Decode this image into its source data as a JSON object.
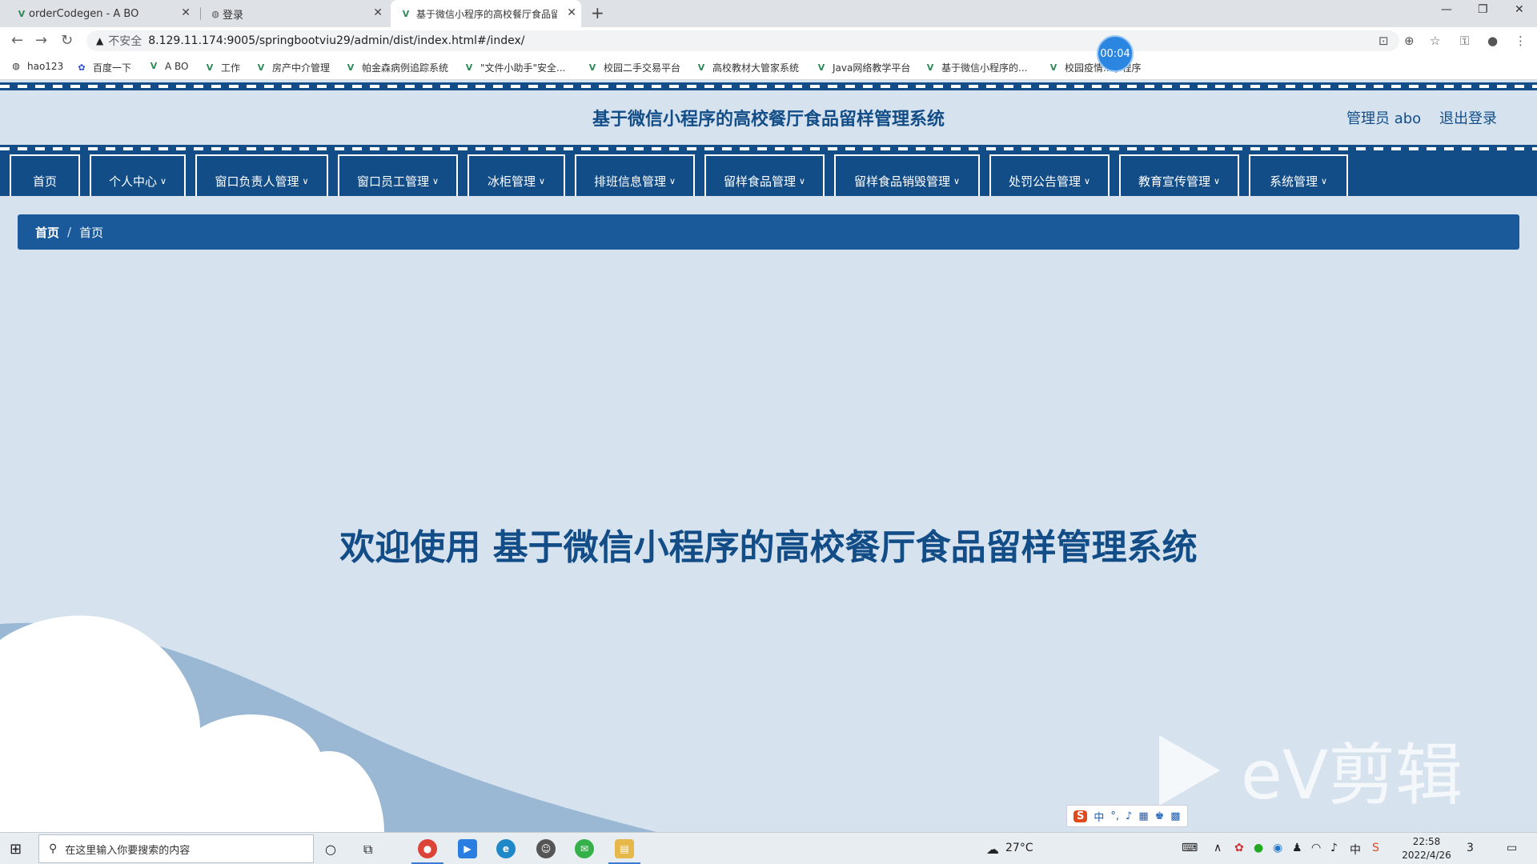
{
  "browser": {
    "tabs": [
      {
        "title": "orderCodegen - A BO"
      },
      {
        "title": "登录"
      },
      {
        "title": "基于微信小程序的高校餐厅食品留"
      }
    ],
    "address": {
      "insecure_label": "不安全",
      "url": "8.129.11.174:9005/springbootviu29/admin/dist/index.html#/index/"
    },
    "bookmarks": [
      "hao123",
      "百度一下",
      "A BO",
      "工作",
      "房产中介管理",
      "帕金森病例追踪系统",
      "\"文件小助手\"安全...",
      "校园二手交易平台",
      "高校教材大管家系统",
      "Java网络教学平台",
      "基于微信小程序的...",
      "校园疫情...小程序"
    ],
    "recording_timer": "00:04"
  },
  "app": {
    "title": "基于微信小程序的高校餐厅食品留样管理系统",
    "user": "管理员 abo",
    "logout": "退出登录",
    "nav": [
      {
        "label": "首页"
      },
      {
        "label": "个人中心"
      },
      {
        "label": "窗口负责人管理"
      },
      {
        "label": "窗口员工管理"
      },
      {
        "label": "冰柜管理"
      },
      {
        "label": "排班信息管理"
      },
      {
        "label": "留样食品管理"
      },
      {
        "label": "留样食品销毁管理"
      },
      {
        "label": "处罚公告管理"
      },
      {
        "label": "教育宣传管理"
      },
      {
        "label": "系统管理"
      }
    ],
    "breadcrumb": [
      "首页",
      "首页"
    ],
    "welcome": "欢迎使用 基于微信小程序的高校餐厅食品留样管理系统"
  },
  "watermark": {
    "text": "eV剪辑"
  },
  "ime": {
    "mode": "中"
  },
  "taskbar": {
    "search_placeholder": "在这里输入你要搜索的内容",
    "weather": "27°C",
    "time": "22:58",
    "date": "2022/4/26",
    "notifications": "3"
  },
  "colors": {
    "primary": "#124d87",
    "background": "#d6e3ef",
    "breadcrumb": "#1a5a9a"
  }
}
